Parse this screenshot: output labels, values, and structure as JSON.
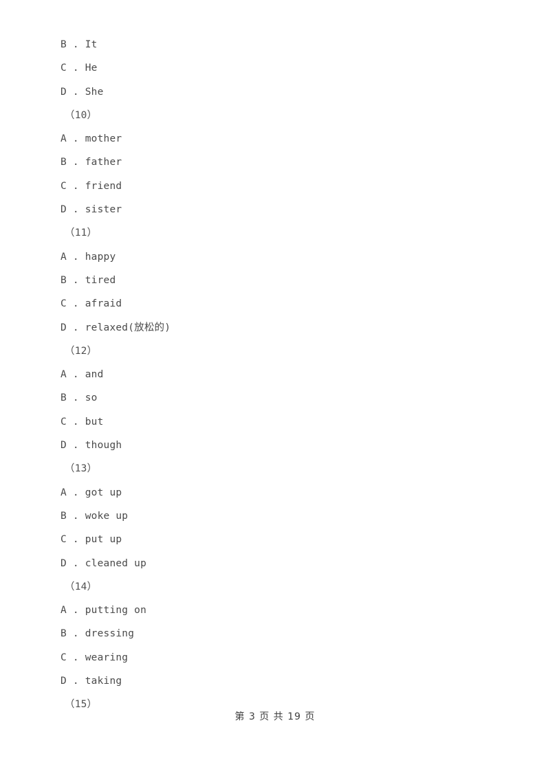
{
  "document": {
    "page_background": "#ffffff",
    "text_color": "#4a4a4a"
  },
  "lines": [
    {
      "kind": "option",
      "text": "B . It"
    },
    {
      "kind": "option",
      "text": "C . He"
    },
    {
      "kind": "option",
      "text": "D . She"
    },
    {
      "kind": "qnum",
      "text": "（10）"
    },
    {
      "kind": "option",
      "text": "A . mother"
    },
    {
      "kind": "option",
      "text": "B . father"
    },
    {
      "kind": "option",
      "text": "C . friend"
    },
    {
      "kind": "option",
      "text": "D . sister"
    },
    {
      "kind": "qnum",
      "text": "（11）"
    },
    {
      "kind": "option",
      "text": "A . happy"
    },
    {
      "kind": "option",
      "text": "B . tired"
    },
    {
      "kind": "option",
      "text": "C . afraid"
    },
    {
      "kind": "option",
      "text": "D . relaxed(放松的)"
    },
    {
      "kind": "qnum",
      "text": "（12）"
    },
    {
      "kind": "option",
      "text": "A . and"
    },
    {
      "kind": "option",
      "text": "B . so"
    },
    {
      "kind": "option",
      "text": "C . but"
    },
    {
      "kind": "option",
      "text": "D . though"
    },
    {
      "kind": "qnum",
      "text": "（13）"
    },
    {
      "kind": "option",
      "text": "A . got up"
    },
    {
      "kind": "option",
      "text": "B . woke up"
    },
    {
      "kind": "option",
      "text": "C . put up"
    },
    {
      "kind": "option",
      "text": "D . cleaned up"
    },
    {
      "kind": "qnum",
      "text": "（14）"
    },
    {
      "kind": "option",
      "text": "A . putting on"
    },
    {
      "kind": "option",
      "text": "B . dressing"
    },
    {
      "kind": "option",
      "text": "C . wearing"
    },
    {
      "kind": "option",
      "text": "D . taking"
    },
    {
      "kind": "qnum",
      "text": "（15）"
    }
  ],
  "footer": {
    "text": "第 3 页 共 19 页",
    "current_page": "3",
    "total_pages": "19"
  }
}
